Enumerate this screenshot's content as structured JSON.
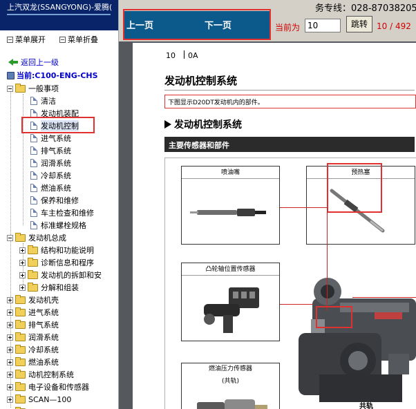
{
  "app": {
    "title": "上汽双龙(SSANGYONG)-爱腾(",
    "menu_expand": "菜单展开",
    "menu_collapse": "菜单折叠",
    "back_link": "返回上一级",
    "current_label": "当前:C100-ENG-CHS"
  },
  "tree": {
    "general": "一般事项",
    "general_items": [
      "清洁",
      "发动机装配",
      "发动机控制",
      "进气系统",
      "排气系统",
      "润滑系统",
      "冷却系统",
      "燃油系统",
      "保养和维修",
      "车主检查和维修",
      "标准螺栓规格"
    ],
    "selected_item": "发动机控制",
    "engine_general": "发动机总成",
    "engine_general_items": [
      "结构和功能说明",
      "诊断信息和程序",
      "发动机的拆卸和安",
      "分解和组装"
    ],
    "top_folders": [
      "发动机壳",
      "进气系统",
      "排气系统",
      "润滑系统",
      "冷却系统",
      "燃油系统",
      "动机控制系统",
      "电子设备和传感器",
      "SCAN—100"
    ]
  },
  "toolbar": {
    "hotline": "务专线：028-87038205",
    "prev": "上一页",
    "next": "下一页",
    "current_page_label": "当前为",
    "page_value": "10",
    "go": "跳转",
    "page_count": "10 / 492"
  },
  "document": {
    "page_number": "10",
    "section": "0A",
    "title": "发动机控制系统",
    "note": "下图显示D20DT发动机内的部件。",
    "subtitle": "发动机控制系统",
    "band": "主要传感器和部件",
    "parts": {
      "injector": "喷油嘴",
      "glow_plug": "预热塞",
      "cam_sensor": "凸轮轴位置传感器",
      "fuel_pressure_sensor": "燃油压力传感器",
      "fuel_pressure_sub": "(共轨)",
      "common_rail": "共轨"
    }
  },
  "colors": {
    "title_bar": "#0a246a",
    "nav_bar": "#0c5a8c",
    "highlight_red": "#e03030",
    "viewer_bg": "#55585c",
    "toolbar_bg": "#d4d0c8"
  }
}
